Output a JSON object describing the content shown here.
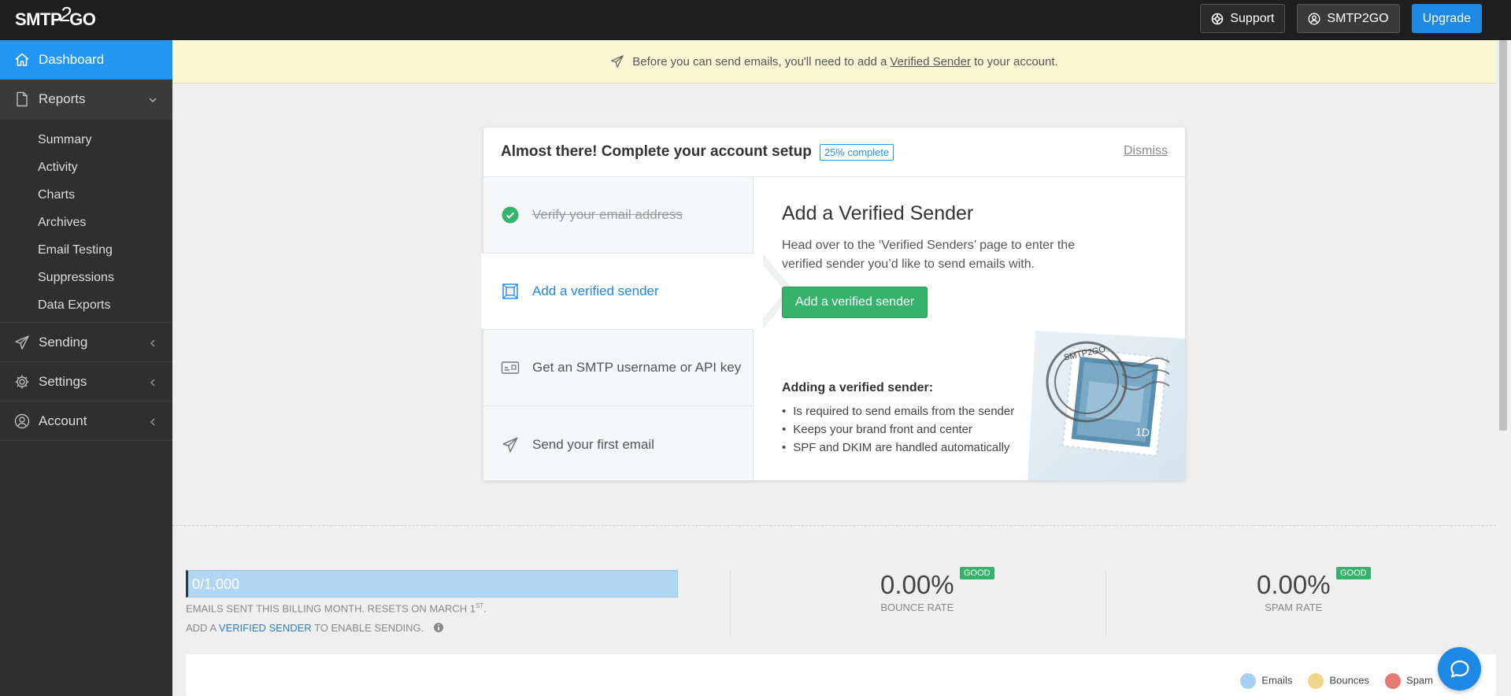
{
  "app": {
    "logo_text_a": "SMTP",
    "logo_text_b": "2",
    "logo_text_c": "GO"
  },
  "topbar": {
    "support_label": "Support",
    "account_label": "SMTP2GO",
    "upgrade_label": "Upgrade"
  },
  "sidebar": {
    "dashboard": "Dashboard",
    "reports": "Reports",
    "report_items": [
      "Summary",
      "Activity",
      "Charts",
      "Archives",
      "Email Testing",
      "Suppressions",
      "Data Exports"
    ],
    "sending": "Sending",
    "settings": "Settings",
    "account": "Account"
  },
  "banner": {
    "text_before": "Before you can send emails, you'll need to add a",
    "link": "Verified Sender",
    "text_after": "to your account."
  },
  "setup": {
    "title": "Almost there! Complete your account setup",
    "progress": "25% complete",
    "dismiss": "Dismiss",
    "steps": [
      {
        "label": "Verify your email address",
        "state": "done"
      },
      {
        "label": "Add a verified sender",
        "state": "active"
      },
      {
        "label": "Get an SMTP username or API key",
        "state": "todo"
      },
      {
        "label": "Send your first email",
        "state": "todo"
      }
    ],
    "detail": {
      "heading": "Add a Verified Sender",
      "body": "Head over to the ‘Verified Senders’ page to enter the verified sender you’d like to send emails with.",
      "button": "Add a verified sender",
      "list_heading": "Adding a verified sender:",
      "bullets": [
        "Is required to send emails from the sender",
        "Keeps your brand front and center",
        "SPF and DKIM are handled automatically"
      ]
    },
    "stamp_text": "SMTP2GO"
  },
  "stats": {
    "quota_value": "0/1,000",
    "quota_fraction": 0,
    "quota_label_a": "EMAILS SENT THIS BILLING MONTH. RESETS ON MARCH 1",
    "quota_label_sup": "ST",
    "quota_note_a": "ADD A",
    "quota_note_link": "VERIFIED SENDER",
    "quota_note_b": "TO ENABLE SENDING.",
    "bounce_rate": "0.00%",
    "bounce_label": "BOUNCE RATE",
    "bounce_badge": "GOOD",
    "spam_rate": "0.00%",
    "spam_label": "SPAM RATE",
    "spam_badge": "GOOD"
  },
  "legend": [
    {
      "label": "Emails",
      "color": "#a8d0f0"
    },
    {
      "label": "Bounces",
      "color": "#f0d58c"
    },
    {
      "label": "Spam",
      "color": "#e57a72"
    }
  ],
  "colors": {
    "accent": "#2196f3",
    "success": "#36b36a",
    "banner_bg": "#fdf6d5"
  }
}
